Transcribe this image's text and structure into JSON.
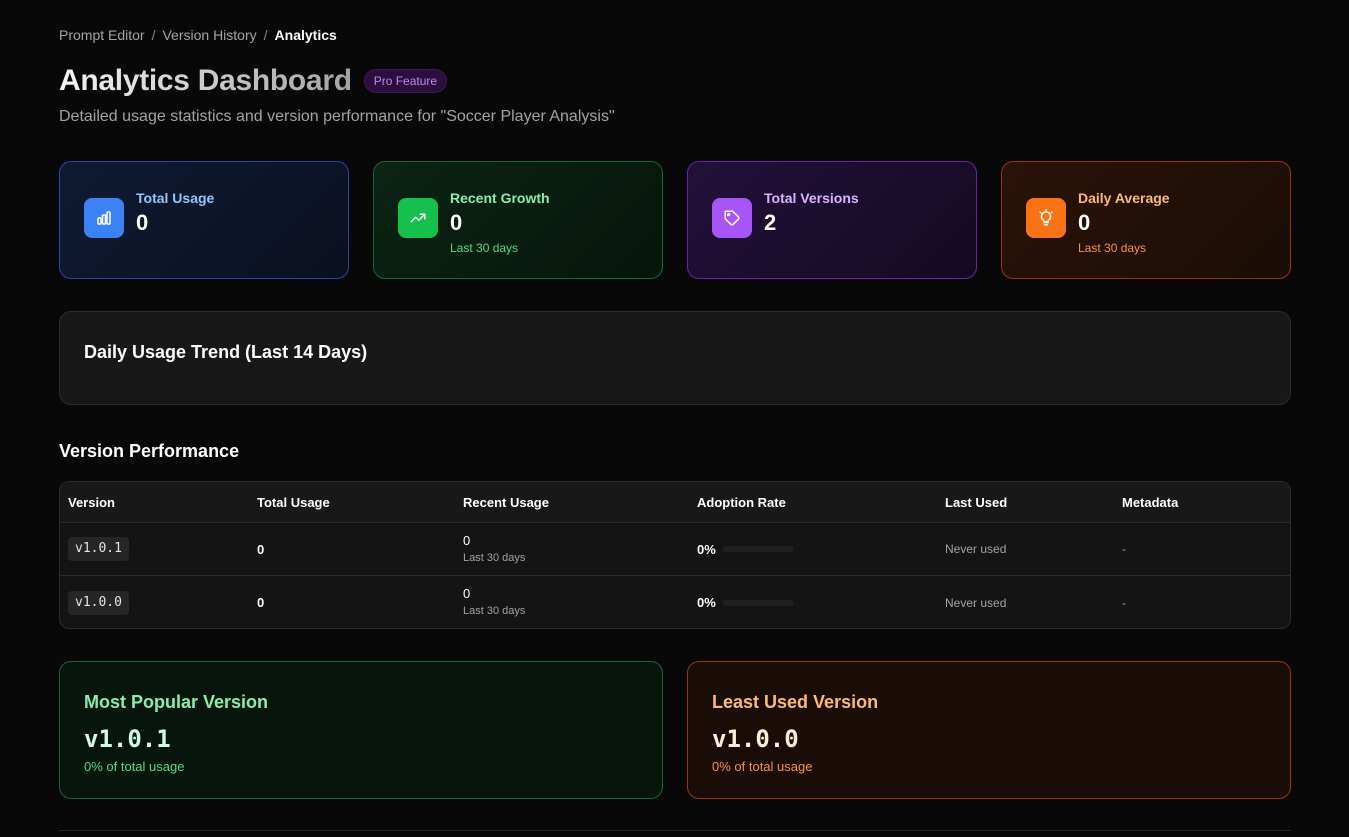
{
  "breadcrumb": {
    "items": [
      "Prompt Editor",
      "Version History",
      "Analytics"
    ],
    "separator": "/"
  },
  "header": {
    "title": "Analytics Dashboard",
    "badge": "Pro Feature",
    "subtitle": "Detailed usage statistics and version performance for \"Soccer Player Analysis\""
  },
  "stats": {
    "total_usage": {
      "label": "Total Usage",
      "value": "0",
      "icon": "bar-chart-icon",
      "color": "#3b82f6"
    },
    "recent_growth": {
      "label": "Recent Growth",
      "value": "0",
      "sub": "Last 30 days",
      "icon": "trending-up-icon",
      "color": "#16c04c"
    },
    "total_versions": {
      "label": "Total Versions",
      "value": "2",
      "icon": "tag-icon",
      "color": "#a855f7"
    },
    "daily_average": {
      "label": "Daily Average",
      "value": "0",
      "sub": "Last 30 days",
      "icon": "lightbulb-icon",
      "color": "#f97316"
    }
  },
  "trend": {
    "title": "Daily Usage Trend (Last 14 Days)"
  },
  "version_performance": {
    "title": "Version Performance",
    "columns": [
      "Version",
      "Total Usage",
      "Recent Usage",
      "Adoption Rate",
      "Last Used",
      "Metadata"
    ],
    "rows": [
      {
        "version": "v1.0.1",
        "total_usage": "0",
        "recent_usage": "0",
        "recent_sub": "Last 30 days",
        "adoption_rate": "0%",
        "adoption_fraction": 0,
        "last_used": "Never used",
        "metadata": "-"
      },
      {
        "version": "v1.0.0",
        "total_usage": "0",
        "recent_usage": "0",
        "recent_sub": "Last 30 days",
        "adoption_rate": "0%",
        "adoption_fraction": 0,
        "last_used": "Never used",
        "metadata": "-"
      }
    ]
  },
  "most_popular": {
    "title": "Most Popular Version",
    "version": "v1.0.1",
    "sub": "0% of total usage"
  },
  "least_used": {
    "title": "Least Used Version",
    "version": "v1.0.0",
    "sub": "0% of total usage"
  }
}
